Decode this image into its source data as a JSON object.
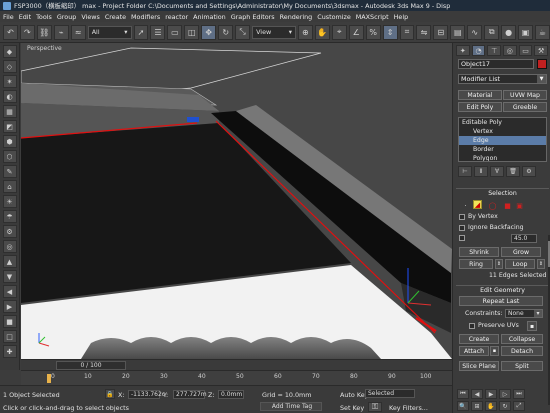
{
  "title_bar": {
    "text": "FSP3000（横板缩印） max  -  Project Folder  C:\\Documents and Settings\\Administrator\\My Documents\\3dsmax  -  Autodesk 3ds Max 9  -  Disp"
  },
  "menu": [
    "File",
    "Edit",
    "Tools",
    "Group",
    "Views",
    "Create",
    "Modifiers",
    "reactor",
    "Animation",
    "Graph Editors",
    "Rendering",
    "Customize",
    "MAXScript",
    "Help"
  ],
  "toolbar": {
    "selection_filter": "All",
    "ref_coord": "View"
  },
  "viewport": {
    "label": "Perspective",
    "frame_counter": "0 / 100"
  },
  "timeline": {
    "ticks": [
      "0",
      "10",
      "20",
      "30",
      "40",
      "50",
      "60",
      "70",
      "80",
      "90",
      "100"
    ]
  },
  "status": {
    "objects_selected": "1 Object Selected",
    "prompt": "Click or click-and-drag to select objects",
    "x_label": "X:",
    "x_value": "-1133.762c",
    "y_label": "Y:",
    "y_value": "277.727m",
    "z_label": "Z:",
    "z_value": "0.0mm",
    "grid": "Grid = 10.0mm",
    "add_time_tag": "Add Time Tag",
    "auto_key": "Auto Key",
    "set_key": "Set Key",
    "key_mode": "Selected",
    "key_filters": "Key Filters..."
  },
  "command_panel": {
    "object_name": "Object17",
    "object_color": "#c02020",
    "modifier_list": "Modifier List",
    "buttons": {
      "material": "Material",
      "uvw_map": "UVW Map",
      "edit_poly": "Edit Poly",
      "greeble": "Greeble"
    },
    "stack": [
      {
        "label": "Editable Poly",
        "level": 0,
        "selected": false
      },
      {
        "label": "Vertex",
        "level": 1,
        "selected": false
      },
      {
        "label": "Edge",
        "level": 1,
        "selected": true
      },
      {
        "label": "Border",
        "level": 1,
        "selected": false
      },
      {
        "label": "Polygon",
        "level": 1,
        "selected": false
      }
    ],
    "selection": {
      "header": "Selection",
      "by_vertex": "By Vertex",
      "ignore_backfacing": "Ignore Backfacing",
      "by_angle_value": "45.0",
      "shrink": "Shrink",
      "grow": "Grow",
      "ring": "Ring",
      "loop": "Loop",
      "status": "11 Edges Selected"
    },
    "edit_geometry": {
      "header": "Edit Geometry",
      "repeat_last": "Repeat Last",
      "constraints_label": "Constraints:",
      "constraints_value": "None",
      "preserve_uvs": "Preserve UVs",
      "create": "Create",
      "collapse": "Collapse",
      "attach": "Attach",
      "detach": "Detach",
      "slice_plane": "Slice Plane",
      "split": "Split"
    }
  }
}
